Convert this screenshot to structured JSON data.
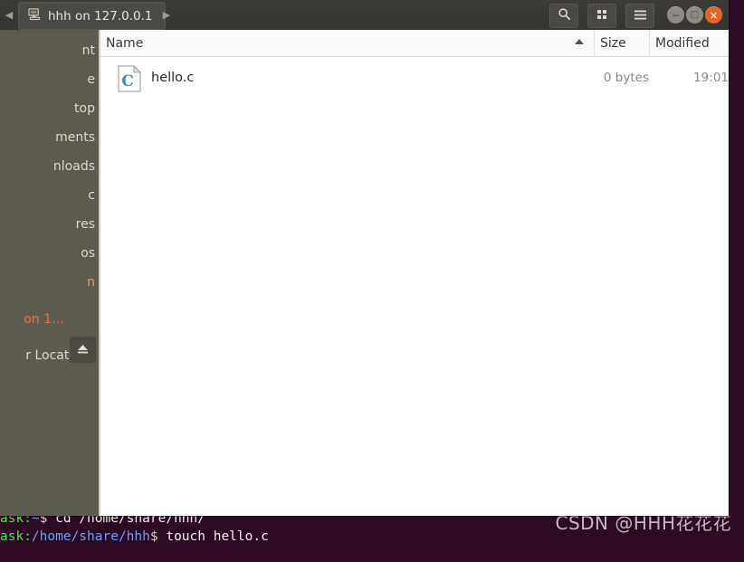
{
  "window": {
    "tab_title": "hhh on 127.0.0.1",
    "nav_back": "◀",
    "nav_forward": "▶",
    "controls": {
      "minimize": "−",
      "maximize": "□",
      "close": "×"
    },
    "toolbar": {
      "search_icon": "search-icon",
      "view_grid_icon": "grid-view-icon",
      "menu_icon": "hamburger-menu-icon"
    }
  },
  "sidebar": {
    "items": [
      {
        "label": "nt",
        "full": "Recent",
        "state": "normal"
      },
      {
        "label": "e",
        "full": "Home",
        "state": "normal"
      },
      {
        "label": "top",
        "full": "Desktop",
        "state": "normal"
      },
      {
        "label": "ments",
        "full": "Documents",
        "state": "normal"
      },
      {
        "label": "nloads",
        "full": "Downloads",
        "state": "normal"
      },
      {
        "label": "c",
        "full": "Music",
        "state": "normal"
      },
      {
        "label": "res",
        "full": "Pictures",
        "state": "normal"
      },
      {
        "label": "os",
        "full": "Videos",
        "state": "normal"
      },
      {
        "label": "n",
        "full": "Trash",
        "state": "trash"
      },
      {
        "label": "on 1…",
        "full": "hhh on 127.0.0.1",
        "state": "active"
      },
      {
        "label": "r Locations",
        "full": "Other Locations",
        "state": "normal"
      }
    ],
    "eject_icon": "eject-icon"
  },
  "file_list": {
    "columns": [
      "Name",
      "Size",
      "Modified"
    ],
    "sort_column": "Name",
    "sort_direction": "ascending",
    "rows": [
      {
        "name": "hello.c",
        "size": "0 bytes",
        "modified": "19:01",
        "icon": "c-source-file-icon"
      }
    ]
  },
  "terminal": {
    "line1": {
      "user_host": "ask:",
      "path": "~",
      "prompt": "$",
      "command": "cd /home/share/hhh/"
    },
    "line2": {
      "user_host": "ask:",
      "path": "/home/share/hhh",
      "prompt": "$",
      "command": "touch hello.c"
    }
  },
  "watermark": "CSDN @HHH花花花",
  "colors": {
    "terminal_bg": "#2d0a23",
    "sidebar_bg": "#5d5a50",
    "titlebar_bg": "#3a3934",
    "accent_orange": "#e8733a",
    "close_button": "#e8632a",
    "prompt_green": "#4ee24e",
    "prompt_blue": "#6c9ef8"
  }
}
